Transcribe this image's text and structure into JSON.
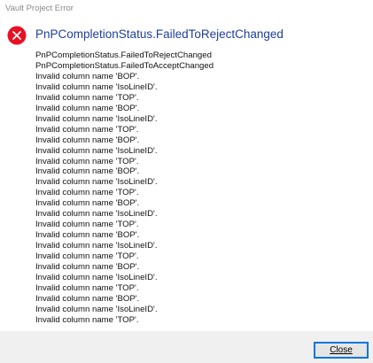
{
  "window": {
    "title": "Vault Project Error"
  },
  "dialog": {
    "icon": "error-icon",
    "heading": "PnPCompletionStatus.FailedToRejectChanged",
    "message_lines": [
      "PnPCompletionStatus.FailedToRejectChanged",
      "PnPCompletionStatus.FailedToAcceptChanged",
      "Invalid column name 'BOP'.",
      "Invalid column name 'IsoLineID'.",
      "Invalid column name 'TOP'.",
      "Invalid column name 'BOP'.",
      "Invalid column name 'IsoLineID'.",
      "Invalid column name 'TOP'.",
      "Invalid column name 'BOP'.",
      "Invalid column name 'IsoLineID'.",
      "Invalid column name 'TOP'.",
      "Invalid column name 'BOP'.",
      "Invalid column name 'IsoLineID'.",
      "Invalid column name 'TOP'.",
      "Invalid column name 'BOP'.",
      "Invalid column name 'IsoLineID'.",
      "Invalid column name 'TOP'.",
      "Invalid column name 'BOP'.",
      "Invalid column name 'IsoLineID'.",
      "Invalid column name 'TOP'.",
      "Invalid column name 'BOP'.",
      "Invalid column name 'IsoLineID'.",
      "Invalid column name 'TOP'.",
      "Invalid column name 'BOP'.",
      "Invalid column name 'IsoLineID'.",
      "Invalid column name 'TOP'."
    ],
    "close_label": "Close"
  },
  "colors": {
    "heading": "#1f3f99",
    "error_red": "#e81123",
    "footer_bg": "#f0f0f0",
    "focus_border": "#0078d7"
  }
}
